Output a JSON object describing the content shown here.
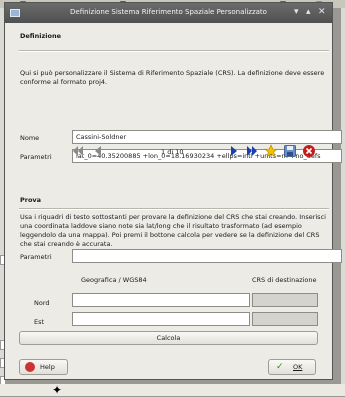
{
  "dialog": {
    "title": "Definizione Sistema Riferimento Spaziale Personalizzato",
    "close_glyph": "✕",
    "minimize_glyph": "▾",
    "maximize_glyph": "▴"
  },
  "definizione": {
    "heading": "Definizione",
    "description": "Qui si può personalizzare il Sistema di Riferimento Spaziale (CRS). La definizione deve essere conforme al formato proj4.",
    "name_label": "Nome",
    "name_value": "Cassini-Soldner",
    "params_label": "Parametri",
    "params_value": "lat_0=40.35200885 +lon_0=18.16930234 +ellps=intl +units=m +no_defs",
    "record_counter": "1 di 10"
  },
  "prova": {
    "heading": "Prova",
    "description": "Usa i riquadri di testo sottostanti per provare la definizione del CRS che stai creando. Inserisci una coordinata laddove siano note sia lat/long che il risultato trasformato (ad esempio leggendolo da una mappa). Poi premi il bottone calcola per vedere se la definizione del CRS che stai creando è accurata.",
    "params_label": "Parametri",
    "params_value": "",
    "geo_header": "Geografica / WGS84",
    "dest_header": "CRS di destinazione",
    "north_label": "Nord",
    "east_label": "Est",
    "north_value": "",
    "east_value": "",
    "calc_button": "Calcola"
  },
  "footer": {
    "help_button": "Help",
    "ok_button": "OK"
  },
  "colors": {
    "nav_gray": "#8a8a8a",
    "nav_blue": "#1c3fae",
    "star_yellow": "#f2c200",
    "delete_red": "#c21d1d"
  }
}
